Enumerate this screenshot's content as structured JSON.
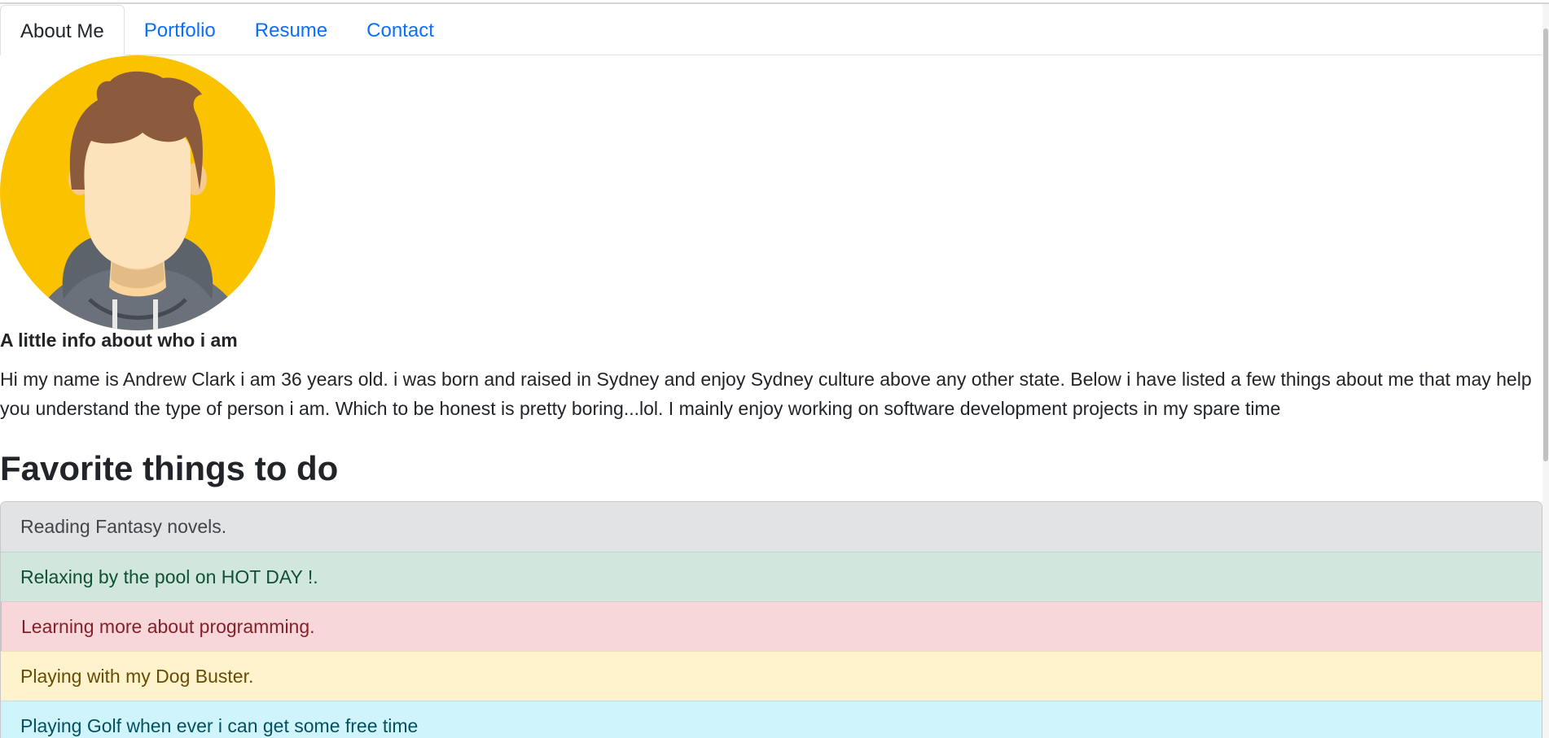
{
  "nav": {
    "tabs": [
      {
        "label": "About Me"
      },
      {
        "label": "Portfolio"
      },
      {
        "label": "Resume"
      },
      {
        "label": "Contact"
      }
    ],
    "active_tab": "About Me"
  },
  "profile": {
    "avatar_icon": "person-avatar-icon",
    "info_heading": "A little info about who i am",
    "bio": "Hi my name is Andrew Clark i am 36 years old. i was born and raised in Sydney and enjoy Sydney culture above any other state. Below i have listed a few things about me that may help you understand the type of person i am. Which to be honest is pretty boring...lol. I mainly enjoy working on software development projects in my spare time"
  },
  "favorites": {
    "heading": "Favorite things to do",
    "items": [
      {
        "label": "Reading Fantasy novels.",
        "variant": "secondary"
      },
      {
        "label": "Relaxing by the pool on HOT DAY !.",
        "variant": "success"
      },
      {
        "label": "Learning more about programming.",
        "variant": "danger"
      },
      {
        "label": "Playing with my Dog Buster.",
        "variant": "warning"
      },
      {
        "label": "Playing Golf when ever i can get some free time",
        "variant": "info"
      }
    ]
  },
  "colors": {
    "link": "#0d6efd",
    "avatar_bg": "#fbc200",
    "hair": "#8c5a3c",
    "skin": "#fce3bb",
    "hoodie": "#6b717a"
  }
}
